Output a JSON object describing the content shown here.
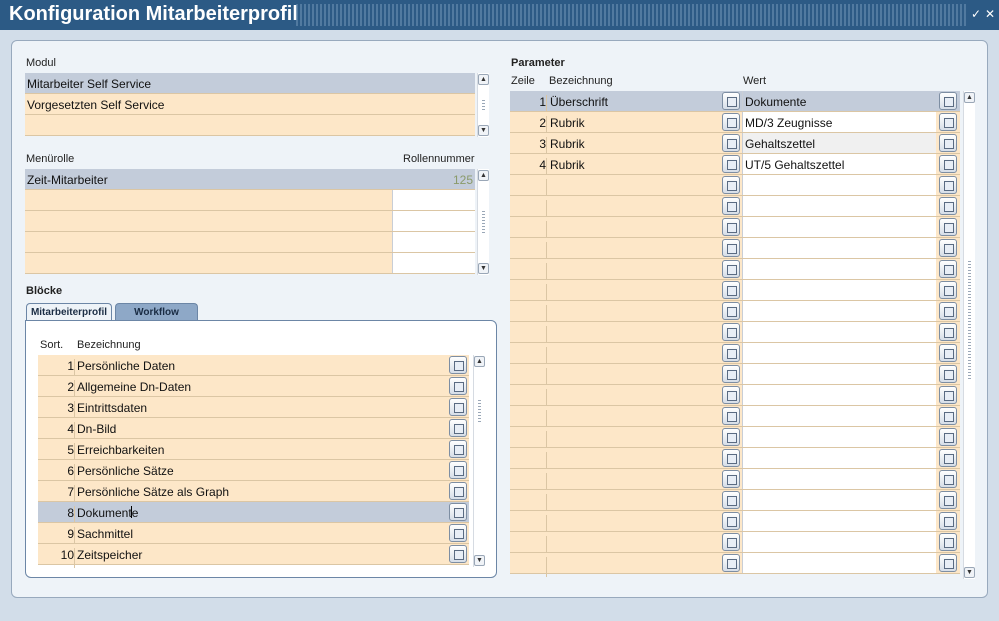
{
  "window": {
    "title": "Konfiguration Mitarbeiterprofil",
    "controls": [
      "✓",
      "✕"
    ]
  },
  "modul": {
    "label": "Modul",
    "items": [
      {
        "label": "Mitarbeiter Self Service",
        "selected": true
      },
      {
        "label": "Vorgesetzten Self Service",
        "selected": false
      },
      {
        "label": "",
        "selected": false
      }
    ]
  },
  "menuerolle": {
    "label": "Menürolle",
    "number_header": "Rollennummer",
    "items": [
      {
        "label": "Zeit-Mitarbeiter",
        "number": "125",
        "selected": true
      },
      {
        "label": "",
        "number": ""
      },
      {
        "label": "",
        "number": ""
      },
      {
        "label": "",
        "number": ""
      },
      {
        "label": "",
        "number": ""
      }
    ]
  },
  "bloecke": {
    "label": "Blöcke",
    "tabs": [
      {
        "label": "Mitarbeiterprofil",
        "active": true
      },
      {
        "label": "Workflow",
        "active": false
      }
    ],
    "col_sort": "Sort.",
    "col_name": "Bezeichnung",
    "rows": [
      {
        "sort": "1",
        "name": "Persönliche Daten"
      },
      {
        "sort": "2",
        "name": "Allgemeine Dn-Daten"
      },
      {
        "sort": "3",
        "name": "Eintrittsdaten"
      },
      {
        "sort": "4",
        "name": "Dn-Bild"
      },
      {
        "sort": "5",
        "name": "Erreichbarkeiten"
      },
      {
        "sort": "6",
        "name": "Persönliche Sätze"
      },
      {
        "sort": "7",
        "name": "Persönliche Sätze als Graph"
      },
      {
        "sort": "8",
        "name": "Dokumente",
        "selected": true
      },
      {
        "sort": "9",
        "name": "Sachmittel"
      },
      {
        "sort": "10",
        "name": "Zeitspeicher"
      }
    ]
  },
  "parameter": {
    "label": "Parameter",
    "col_zeile": "Zeile",
    "col_bez": "Bezeichnung",
    "col_wert": "Wert",
    "rows": [
      {
        "zeile": "1",
        "bez": "Überschrift",
        "wert": "Dokumente",
        "selected": true
      },
      {
        "zeile": "2",
        "bez": "Rubrik",
        "wert": "MD/3 Zeugnisse"
      },
      {
        "zeile": "3",
        "bez": "Rubrik",
        "wert": "Gehaltszettel"
      },
      {
        "zeile": "4",
        "bez": "Rubrik",
        "wert": "UT/5 Gehaltszettel"
      },
      {
        "zeile": "",
        "bez": "",
        "wert": ""
      },
      {
        "zeile": "",
        "bez": "",
        "wert": ""
      },
      {
        "zeile": "",
        "bez": "",
        "wert": ""
      },
      {
        "zeile": "",
        "bez": "",
        "wert": ""
      },
      {
        "zeile": "",
        "bez": "",
        "wert": ""
      },
      {
        "zeile": "",
        "bez": "",
        "wert": ""
      },
      {
        "zeile": "",
        "bez": "",
        "wert": ""
      },
      {
        "zeile": "",
        "bez": "",
        "wert": ""
      },
      {
        "zeile": "",
        "bez": "",
        "wert": ""
      },
      {
        "zeile": "",
        "bez": "",
        "wert": ""
      },
      {
        "zeile": "",
        "bez": "",
        "wert": ""
      },
      {
        "zeile": "",
        "bez": "",
        "wert": ""
      },
      {
        "zeile": "",
        "bez": "",
        "wert": ""
      },
      {
        "zeile": "",
        "bez": "",
        "wert": ""
      },
      {
        "zeile": "",
        "bez": "",
        "wert": ""
      },
      {
        "zeile": "",
        "bez": "",
        "wert": ""
      },
      {
        "zeile": "",
        "bez": "",
        "wert": ""
      },
      {
        "zeile": "",
        "bez": "",
        "wert": ""
      },
      {
        "zeile": "",
        "bez": "",
        "wert": ""
      }
    ]
  },
  "colors": {
    "title_bg": "#2c5a85",
    "row_peach": "#fde7c8",
    "row_selected": "#c3ccda",
    "number_gray": "#8a9a6a"
  }
}
